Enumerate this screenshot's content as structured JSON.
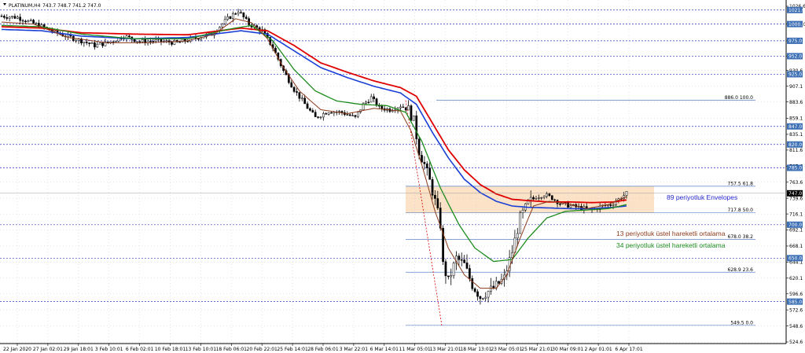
{
  "header": {
    "symbol_label": "PLATINUM,H4",
    "ohlc_label": "743.7 748.7 741.2 747.0"
  },
  "colors": {
    "background": "#ffffff",
    "frame": "#000000",
    "grid": "#c8c8e6",
    "hline": "#3333cc",
    "hline_badge": "#3d6fb5",
    "candle": "#000000",
    "ema13": "#8b3a1a",
    "ema34": "#1e8b1e",
    "env_blue": "#1a3fd6",
    "env_red": "#e00000",
    "zone_fill": "#fbd8b4",
    "fib": "#5b86c4",
    "fib_text": "#4a73b0",
    "trend": "#e00000",
    "text_env": "#2a2ad0",
    "text_ema13": "#8b3a1a",
    "text_ema34": "#1e8b1e"
  },
  "chart_data": {
    "type": "candlestick",
    "symbol": "PLATINUM",
    "timeframe": "H4",
    "ylim": [
      524.6,
      1026.6
    ],
    "y_ticks": [
      "1026.6",
      "1000.0",
      "975.0",
      "952.0",
      "930.6",
      "907.1",
      "883.6",
      "859.1",
      "835.1",
      "811.6",
      "787.6",
      "763.6",
      "739.6",
      "716.1",
      "692.1",
      "668.1",
      "644.1",
      "620.1",
      "596.6",
      "572.6",
      "548.6",
      "524.6"
    ],
    "x_ticks": [
      "22 Jan 2020",
      "27 Jan 02:01",
      "29 Jan 18:01",
      "3 Feb 10:01",
      "6 Feb 02:01",
      "10 Feb 18:01",
      "13 Feb 10:01",
      "18 Feb 06:01",
      "20 Feb 22:01",
      "25 Feb 14:01",
      "28 Feb 06:01",
      "3 Mar 22:01",
      "6 Mar 14:01",
      "11 Mar 05:01",
      "13 Mar 21:01",
      "18 Mar 13:01",
      "23 Mar 05:01",
      "25 Mar 21:01",
      "30 Mar 09:01",
      "2 Apr 01:01",
      "6 Apr 17:01"
    ],
    "current_price": "747.0",
    "horizontal_levels": [
      "1021.0",
      "1000.0",
      "975.0",
      "952.0",
      "925.0",
      "847.0",
      "820.0",
      "785.0",
      "700.0",
      "650.0",
      "585.0"
    ],
    "fibonacci": [
      {
        "label": "886.0 100.0",
        "price": 886.0
      },
      {
        "label": "757.5 61.8",
        "price": 757.5
      },
      {
        "label": "717.8 50.0",
        "price": 717.8
      },
      {
        "label": "678.0 38.2",
        "price": 678.0
      },
      {
        "label": "628.9 23.6",
        "price": 628.9
      },
      {
        "label": "549.5 0.0",
        "price": 549.5
      }
    ],
    "zone": {
      "low": 717.8,
      "high": 757.5
    },
    "annotations": {
      "envelopes": "89 periyotluk Envelopes",
      "ema13": "13 periyotluk üstel hareketli ortalama",
      "ema34": "34 periyotluk üstel hareketli ortalama"
    },
    "trend_line": {
      "from_price": 886.0,
      "to_price": 549.5
    },
    "series_keypoints": [
      {
        "name": "Price",
        "points": [
          [
            0,
            1012
          ],
          [
            6,
            1010
          ],
          [
            14,
            998
          ],
          [
            22,
            985
          ],
          [
            30,
            975
          ],
          [
            35,
            968
          ],
          [
            40,
            972
          ],
          [
            46,
            982
          ],
          [
            52,
            974
          ],
          [
            58,
            975
          ],
          [
            66,
            972
          ],
          [
            72,
            978
          ],
          [
            79,
            985
          ],
          [
            85,
            1008
          ],
          [
            89,
            1020
          ],
          [
            93,
            1000
          ],
          [
            98,
            990
          ],
          [
            102,
            965
          ],
          [
            106,
            930
          ],
          [
            110,
            902
          ],
          [
            115,
            875
          ],
          [
            118,
            860
          ],
          [
            123,
            870
          ],
          [
            128,
            868
          ],
          [
            133,
            860
          ],
          [
            136,
            880
          ],
          [
            139,
            890
          ],
          [
            142,
            875
          ],
          [
            146,
            872
          ],
          [
            150,
            878
          ],
          [
            153,
            872
          ],
          [
            155,
            855
          ],
          [
            157,
            810
          ],
          [
            159,
            790
          ],
          [
            161,
            765
          ],
          [
            163,
            735
          ],
          [
            165,
            700
          ],
          [
            166,
            640
          ],
          [
            168,
            615
          ],
          [
            171,
            650
          ],
          [
            174,
            640
          ],
          [
            177,
            610
          ],
          [
            180,
            592
          ],
          [
            182,
            598
          ],
          [
            185,
            605
          ],
          [
            189,
            620
          ],
          [
            192,
            660
          ],
          [
            195,
            710
          ],
          [
            198,
            732
          ],
          [
            201,
            742
          ],
          [
            204,
            745
          ],
          [
            207,
            740
          ],
          [
            210,
            732
          ],
          [
            214,
            728
          ],
          [
            218,
            725
          ],
          [
            222,
            722
          ],
          [
            226,
            728
          ],
          [
            229,
            730
          ],
          [
            232,
            738
          ],
          [
            235,
            747
          ]
        ]
      },
      {
        "name": "EMA13",
        "points": [
          [
            0,
            1003
          ],
          [
            12,
            1000
          ],
          [
            25,
            980
          ],
          [
            40,
            972
          ],
          [
            55,
            972
          ],
          [
            70,
            975
          ],
          [
            80,
            985
          ],
          [
            88,
            1008
          ],
          [
            94,
            1002
          ],
          [
            100,
            978
          ],
          [
            106,
            935
          ],
          [
            112,
            900
          ],
          [
            120,
            872
          ],
          [
            130,
            866
          ],
          [
            140,
            874
          ],
          [
            150,
            870
          ],
          [
            154,
            840
          ],
          [
            158,
            790
          ],
          [
            163,
            720
          ],
          [
            168,
            665
          ],
          [
            174,
            625
          ],
          [
            180,
            605
          ],
          [
            186,
            605
          ],
          [
            190,
            625
          ],
          [
            195,
            680
          ],
          [
            200,
            728
          ],
          [
            206,
            735
          ],
          [
            212,
            732
          ],
          [
            220,
            724
          ],
          [
            228,
            730
          ],
          [
            235,
            742
          ]
        ]
      },
      {
        "name": "EMA34",
        "points": [
          [
            0,
            998
          ],
          [
            15,
            996
          ],
          [
            30,
            985
          ],
          [
            50,
            978
          ],
          [
            70,
            978
          ],
          [
            85,
            992
          ],
          [
            94,
            998
          ],
          [
            102,
            975
          ],
          [
            110,
            932
          ],
          [
            118,
            900
          ],
          [
            126,
            885
          ],
          [
            135,
            880
          ],
          [
            145,
            878
          ],
          [
            152,
            868
          ],
          [
            158,
            825
          ],
          [
            165,
            755
          ],
          [
            172,
            700
          ],
          [
            178,
            665
          ],
          [
            185,
            645
          ],
          [
            192,
            648
          ],
          [
            198,
            680
          ],
          [
            205,
            710
          ],
          [
            212,
            720
          ],
          [
            220,
            722
          ],
          [
            228,
            724
          ],
          [
            235,
            730
          ]
        ]
      },
      {
        "name": "Envelope lower",
        "points": [
          [
            0,
            992
          ],
          [
            15,
            990
          ],
          [
            30,
            982
          ],
          [
            50,
            978
          ],
          [
            70,
            980
          ],
          [
            90,
            990
          ],
          [
            100,
            985
          ],
          [
            110,
            960
          ],
          [
            120,
            935
          ],
          [
            130,
            920
          ],
          [
            140,
            907
          ],
          [
            150,
            897
          ],
          [
            156,
            880
          ],
          [
            162,
            838
          ],
          [
            168,
            800
          ],
          [
            174,
            768
          ],
          [
            180,
            748
          ],
          [
            186,
            735
          ],
          [
            192,
            728
          ],
          [
            198,
            726
          ],
          [
            206,
            725
          ],
          [
            214,
            724
          ],
          [
            222,
            724
          ],
          [
            230,
            726
          ],
          [
            235,
            728
          ]
        ]
      },
      {
        "name": "Envelope upper",
        "points": [
          [
            0,
            996
          ],
          [
            15,
            994
          ],
          [
            30,
            987
          ],
          [
            50,
            985
          ],
          [
            70,
            984
          ],
          [
            90,
            994
          ],
          [
            100,
            990
          ],
          [
            110,
            968
          ],
          [
            120,
            942
          ],
          [
            130,
            928
          ],
          [
            140,
            915
          ],
          [
            150,
            905
          ],
          [
            156,
            892
          ],
          [
            162,
            852
          ],
          [
            168,
            812
          ],
          [
            174,
            782
          ],
          [
            180,
            760
          ],
          [
            186,
            746
          ],
          [
            192,
            738
          ],
          [
            198,
            736
          ],
          [
            206,
            734
          ],
          [
            214,
            734
          ],
          [
            222,
            733
          ],
          [
            230,
            734
          ],
          [
            235,
            737
          ]
        ]
      }
    ]
  }
}
